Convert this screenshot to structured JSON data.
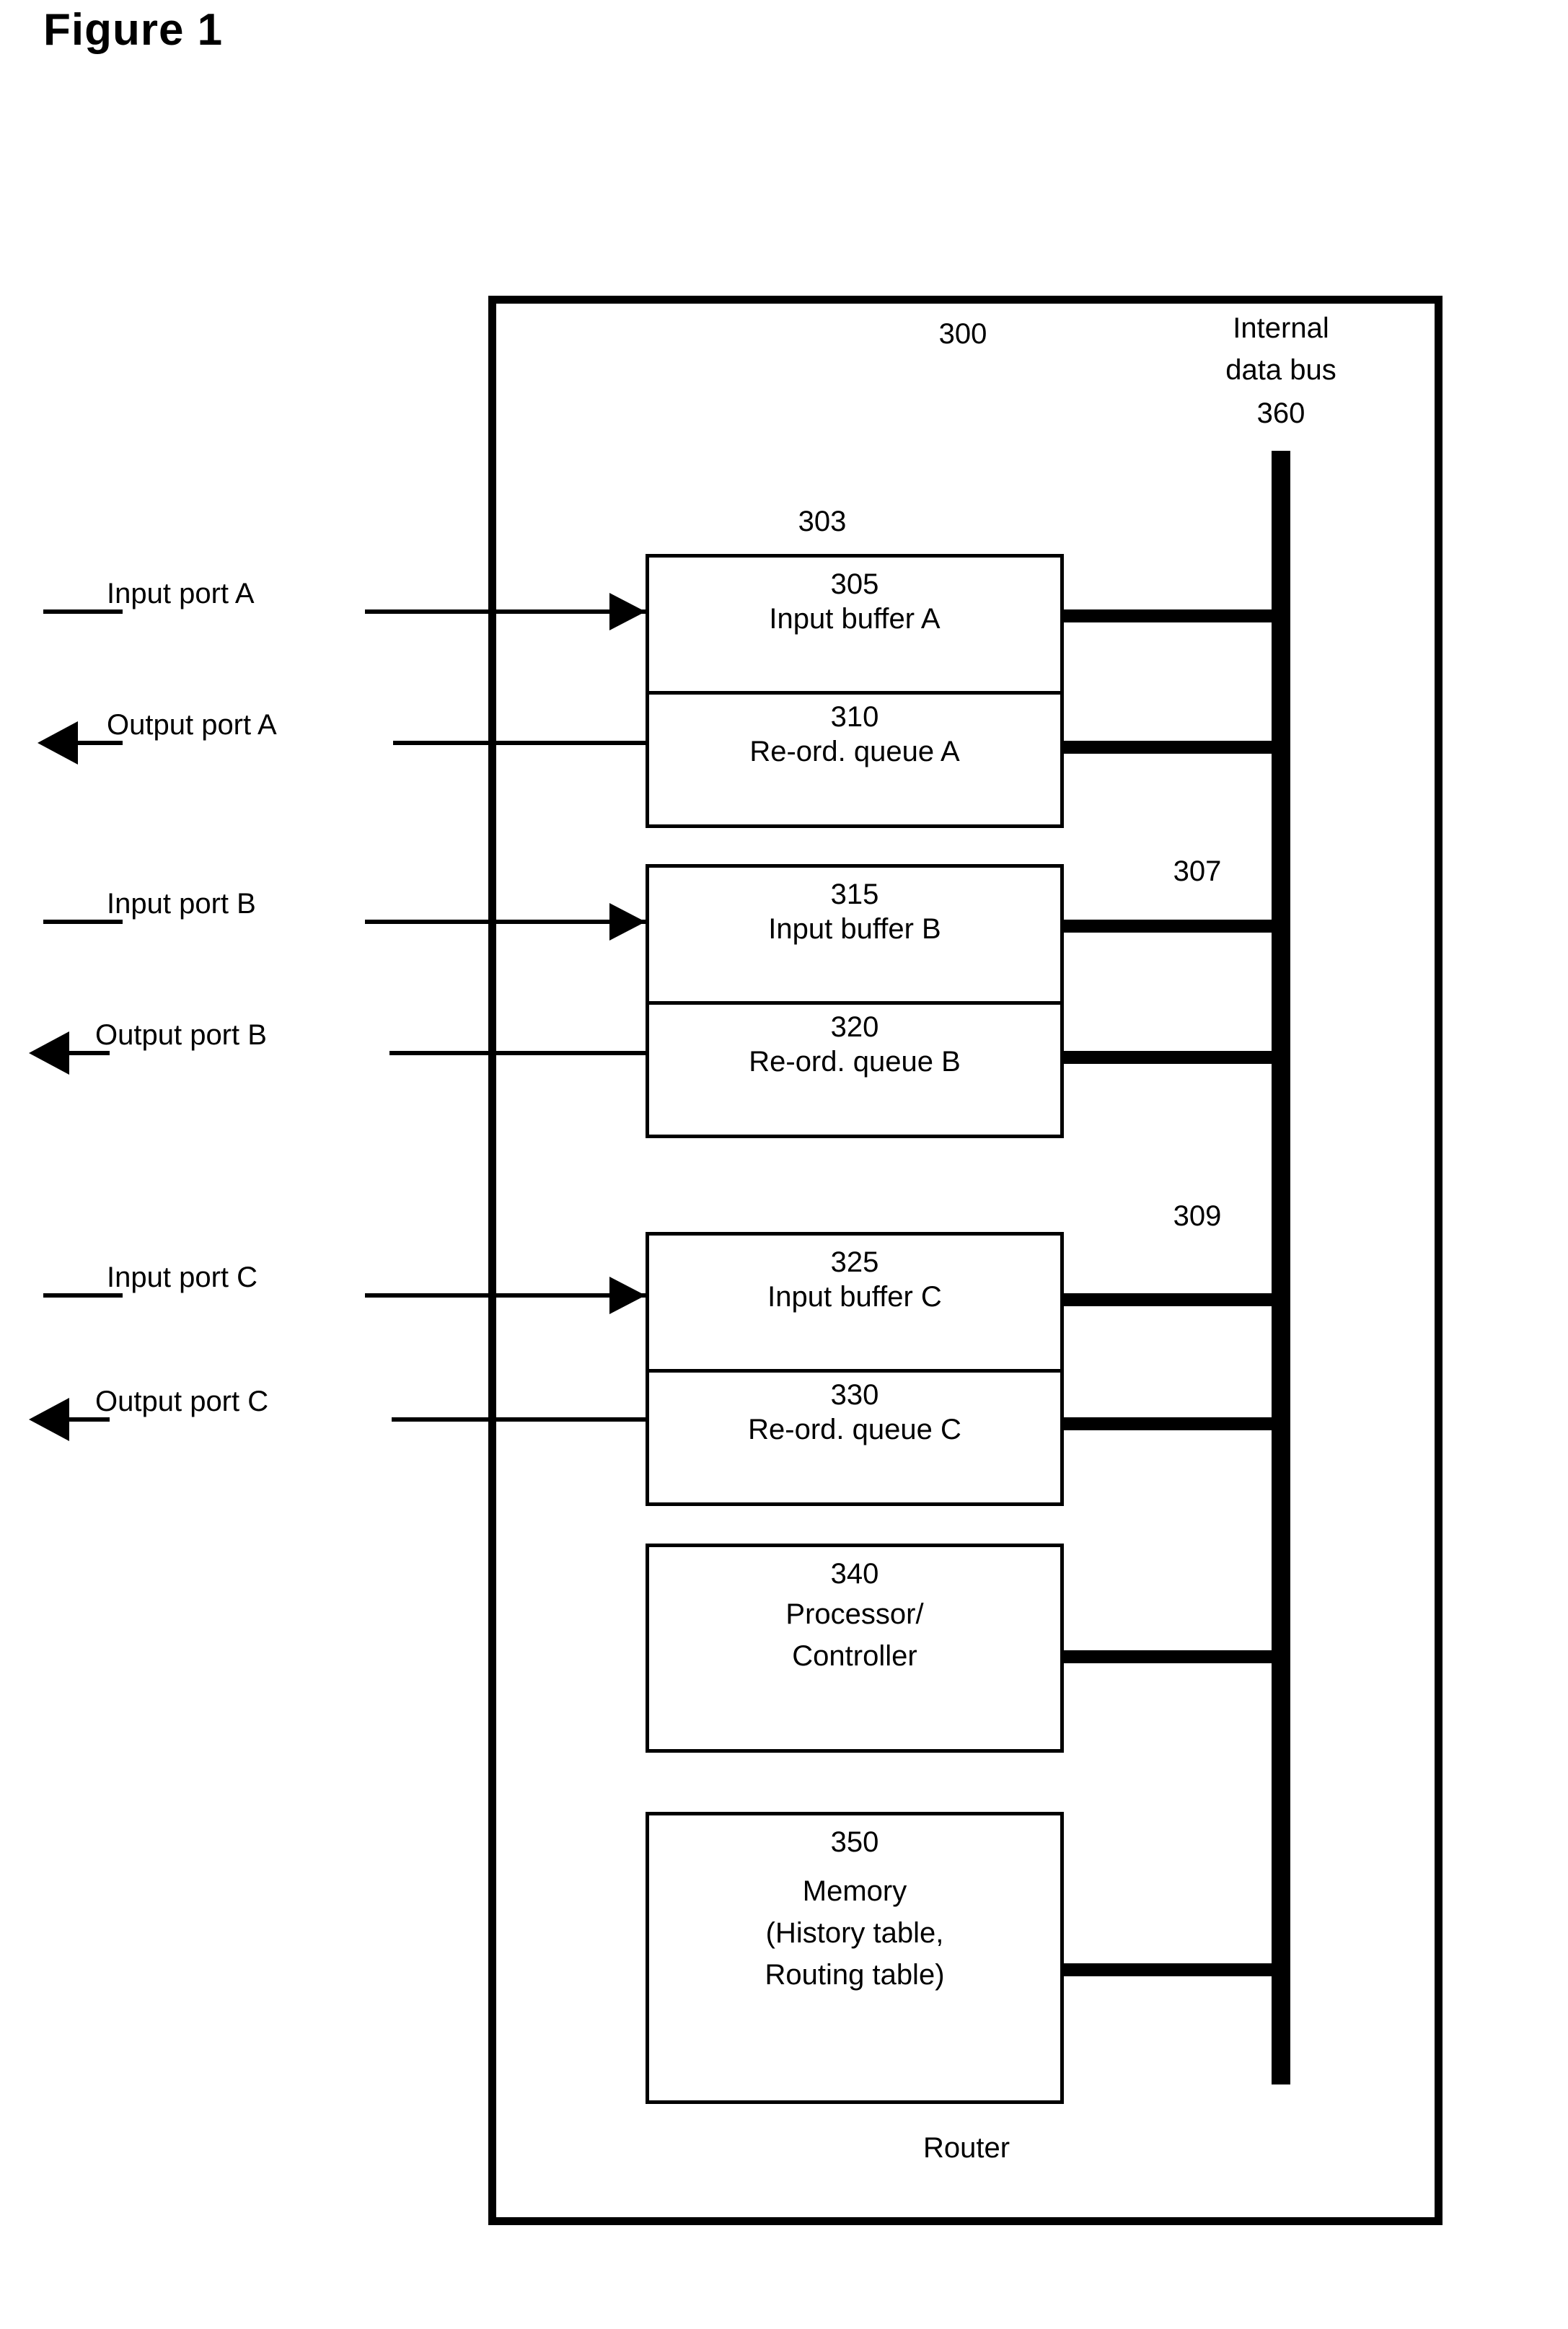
{
  "figure": {
    "title": "Figure 1"
  },
  "router": {
    "frame_ref": "300",
    "caption": "Router",
    "bus": {
      "label_line1": "Internal",
      "label_line2": "data bus",
      "ref": "360"
    },
    "port_groups": [
      {
        "group_ref": "303",
        "input_port_label": "Input port A",
        "output_port_label": "Output port A",
        "buffer_ref": "305",
        "buffer_label": "Input buffer A",
        "queue_ref": "310",
        "queue_label": "Re-ord. queue A"
      },
      {
        "group_ref": "307",
        "input_port_label": "Input port B",
        "output_port_label": "Output port B",
        "buffer_ref": "315",
        "buffer_label": "Input buffer B",
        "queue_ref": "320",
        "queue_label": "Re-ord. queue B"
      },
      {
        "group_ref": "309",
        "input_port_label": "Input port C",
        "output_port_label": "Output port C",
        "buffer_ref": "325",
        "buffer_label": "Input buffer C",
        "queue_ref": "330",
        "queue_label": "Re-ord. queue C"
      }
    ],
    "processor": {
      "ref": "340",
      "label_line1": "Processor/",
      "label_line2": "Controller"
    },
    "memory": {
      "ref": "350",
      "label_line1": "Memory",
      "label_line2": "(History table,",
      "label_line3": "Routing table)"
    }
  },
  "colors": {
    "ink": "#000000",
    "paper": "#ffffff"
  }
}
